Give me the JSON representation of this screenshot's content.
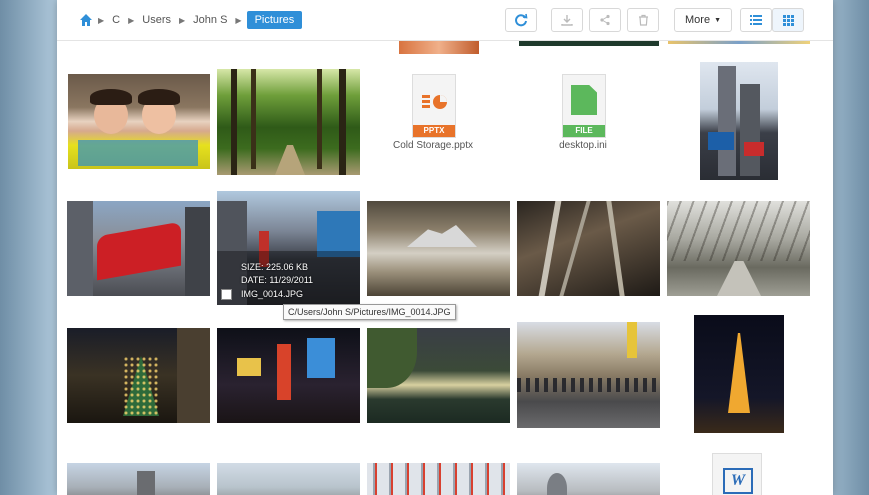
{
  "breadcrumb": {
    "segments": [
      "C",
      "Users",
      "John S"
    ],
    "current": "Pictures"
  },
  "toolbar": {
    "more_label": "More"
  },
  "files": {
    "pptx_badge": "PPTX",
    "pptx_name": "Cold Storage.pptx",
    "ini_badge": "FILE",
    "ini_name": "desktop.ini",
    "word_letter": "W"
  },
  "selected_item": {
    "size_text": "SIZE: 225.06 KB",
    "date_text": "DATE: 11/29/2011",
    "name_text": "IMG_0014.JPG",
    "tooltip": "C/Users/John S/Pictures/IMG_0014.JPG"
  },
  "colors": {
    "accent": "#2f8fd8",
    "pptx_orange": "#e8732a",
    "ini_green": "#5cb85c"
  }
}
